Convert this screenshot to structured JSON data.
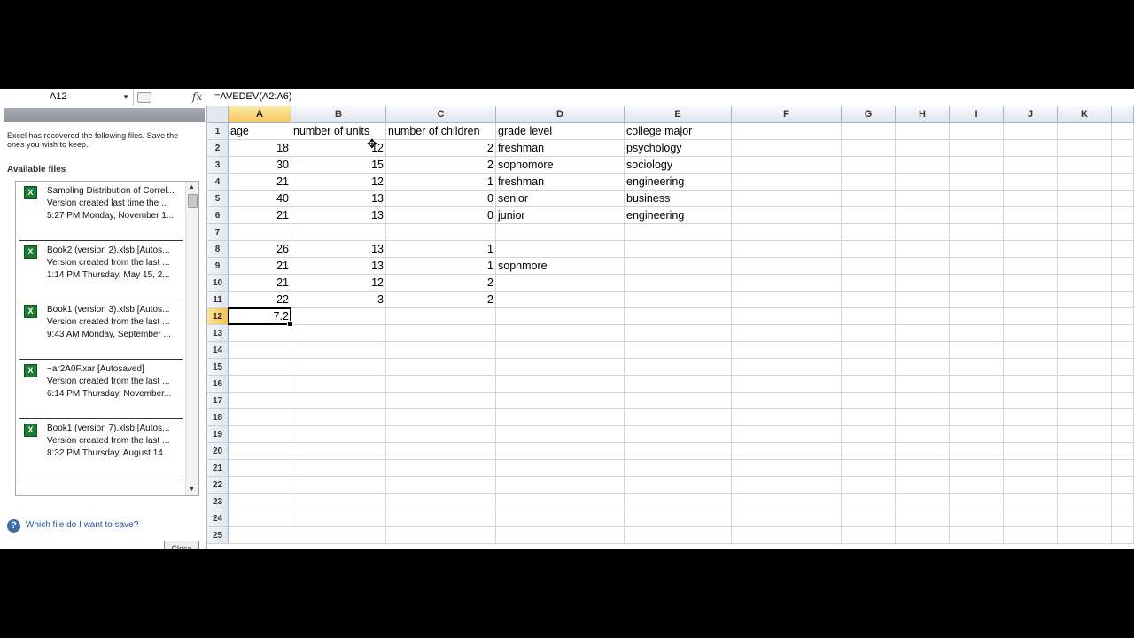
{
  "formula_bar": {
    "name_box": "A12",
    "fx_icon": "fx-icon",
    "formula": "=AVEDEV(A2:A6)"
  },
  "recovery_pane": {
    "description": "Excel has recovered the following files.  Save the ones you wish to keep.",
    "available_heading": "Available files",
    "files": [
      {
        "name": "Sampling Distribution of Correl...",
        "line2": "Version created last time the ...",
        "line3": "5:27 PM Monday, November 1..."
      },
      {
        "name": "Book2 (version 2).xlsb  [Autos...",
        "line2": "Version created from the last ...",
        "line3": "1:14 PM Thursday, May 15, 2..."
      },
      {
        "name": "Book1 (version 3).xlsb  [Autos...",
        "line2": "Version created from the last ...",
        "line3": "9:43 AM Monday, September ..."
      },
      {
        "name": "~ar2A0F.xar  [Autosaved]",
        "line2": "Version created from the last ...",
        "line3": "6:14 PM Thursday, November..."
      },
      {
        "name": "Book1 (version 7).xlsb  [Autos...",
        "line2": "Version created from the last ...",
        "line3": "8:32 PM Thursday, August 14..."
      }
    ],
    "help_link": "Which file do I want to save?",
    "close_label": "Close"
  },
  "sheet": {
    "columns": [
      "A",
      "B",
      "C",
      "D",
      "E",
      "F",
      "G",
      "H",
      "I",
      "J",
      "K"
    ],
    "selected_column": "A",
    "selected_row": 12,
    "row_count": 25,
    "rows": [
      [
        "age",
        "number of units",
        "number of children",
        "grade level",
        "college major"
      ],
      [
        "18",
        "12",
        "2",
        "freshman",
        "psychology"
      ],
      [
        "30",
        "15",
        "2",
        "sophomore",
        "sociology"
      ],
      [
        "21",
        "12",
        "1",
        "freshman",
        "engineering"
      ],
      [
        "40",
        "13",
        "0",
        "senior",
        "business"
      ],
      [
        "21",
        "13",
        "0",
        "junior",
        "engineering"
      ],
      [
        "",
        "",
        "",
        "",
        ""
      ],
      [
        "26",
        "13",
        "1",
        "",
        ""
      ],
      [
        "21",
        "13",
        "1",
        "sophmore",
        ""
      ],
      [
        "21",
        "12",
        "2",
        "",
        ""
      ],
      [
        "22",
        "3",
        "2",
        "",
        ""
      ],
      [
        "7.2",
        "",
        "",
        "",
        ""
      ]
    ]
  }
}
